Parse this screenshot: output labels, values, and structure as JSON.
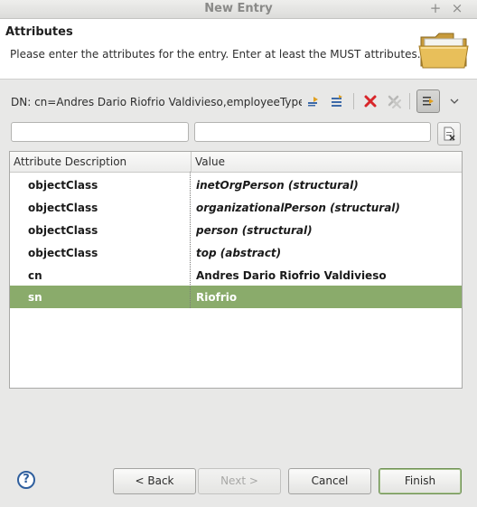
{
  "window": {
    "title": "New Entry",
    "pin_glyph": "+",
    "close_glyph": "×"
  },
  "header": {
    "title": "Attributes",
    "description": "Please enter the attributes for the entry. Enter at least the MUST attributes."
  },
  "dn": {
    "text": "DN: cn=Andres Dario Riofrio Valdivieso,employeeType=Ar"
  },
  "toolbar": {
    "icons": [
      "new-attribute-icon",
      "new-value-icon",
      "delete-icon",
      "delete-all-icon",
      "show-raw-values-icon",
      "view-menu-icon"
    ],
    "colors": {
      "delete": "#d8262a",
      "toggle_bg": "#c8c8c6"
    }
  },
  "filter": {
    "attribute_value": "",
    "value_value": ""
  },
  "table": {
    "columns": [
      "Attribute Description",
      "Value"
    ],
    "rows": [
      {
        "attribute": "objectClass",
        "value": "inetOrgPerson (structural)",
        "italic": true,
        "selected": false
      },
      {
        "attribute": "objectClass",
        "value": "organizationalPerson (structural)",
        "italic": true,
        "selected": false
      },
      {
        "attribute": "objectClass",
        "value": "person (structural)",
        "italic": true,
        "selected": false
      },
      {
        "attribute": "objectClass",
        "value": "top (abstract)",
        "italic": true,
        "selected": false
      },
      {
        "attribute": "cn",
        "value": "Andres Dario Riofrio Valdivieso",
        "italic": false,
        "selected": false
      },
      {
        "attribute": "sn",
        "value": "Riofrio",
        "italic": false,
        "selected": true
      }
    ],
    "selection_color": "#8aab6b"
  },
  "buttons": {
    "back": "< Back",
    "next": "Next >",
    "cancel": "Cancel",
    "finish": "Finish",
    "help_glyph": "?"
  }
}
